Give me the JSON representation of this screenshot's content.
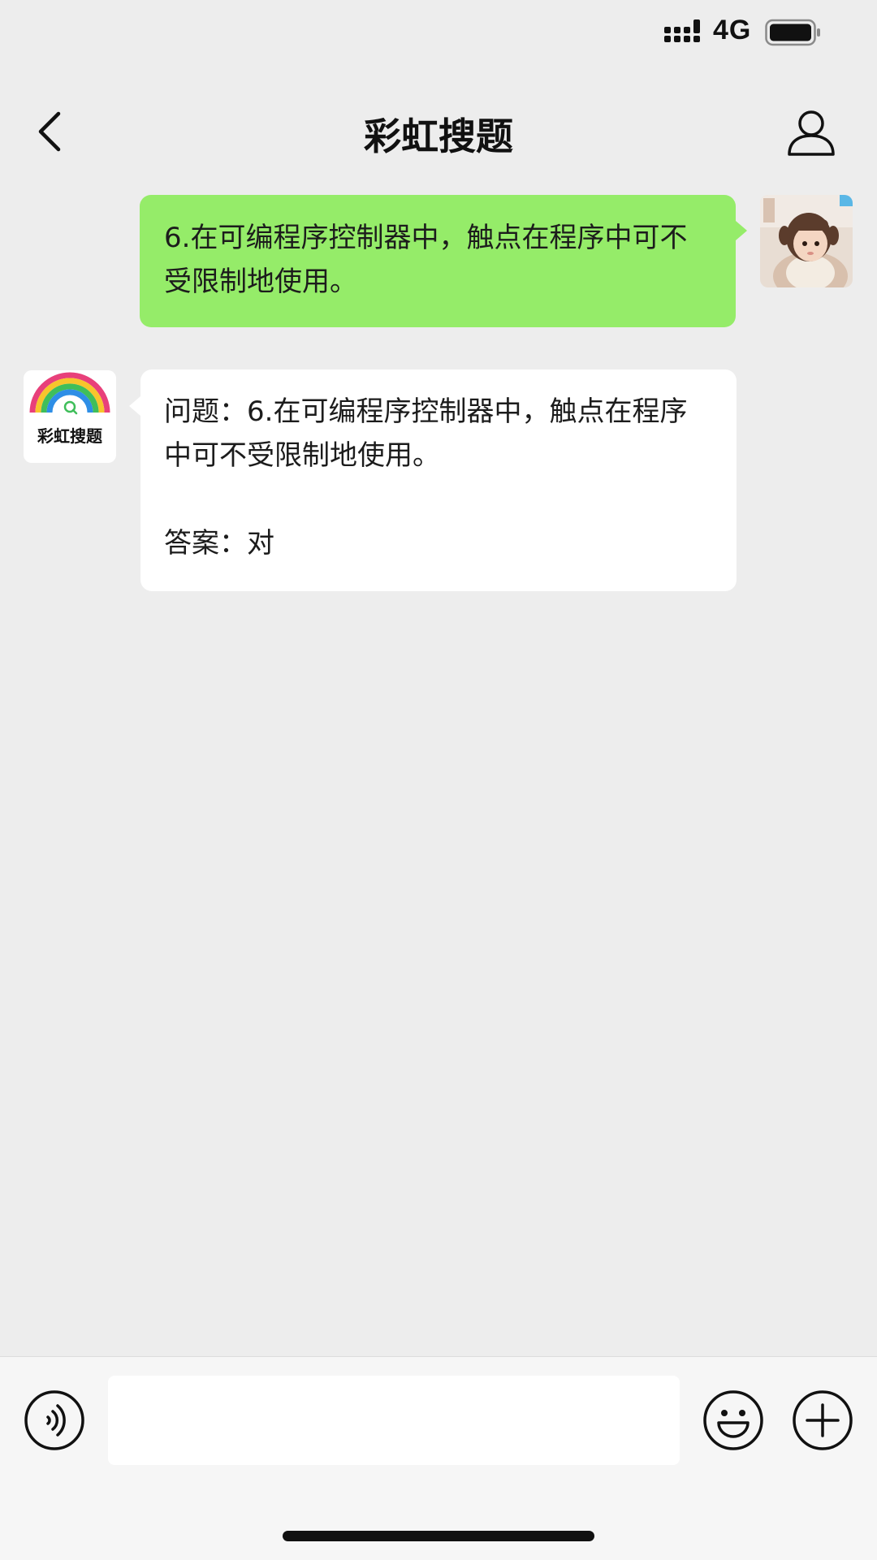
{
  "status_bar": {
    "network": "4G"
  },
  "nav": {
    "title": "彩虹搜题",
    "back_icon": "chevron-left-icon",
    "profile_icon": "person-icon"
  },
  "messages": [
    {
      "sender": "me",
      "text": "6.在可编程序控制器中，触点在程序中可不受限制地使用。",
      "bubble_color": "#95ec69"
    },
    {
      "sender": "bot",
      "logo_text": "彩虹搜题",
      "question": "问题：6.在可编程序控制器中，触点在程序中可不受限制地使用。",
      "answer": "答案：对",
      "bubble_color": "#ffffff"
    }
  ],
  "input_bar": {
    "value": "",
    "voice_icon": "voice-icon",
    "emoji_icon": "emoji-icon",
    "plus_icon": "plus-icon"
  }
}
